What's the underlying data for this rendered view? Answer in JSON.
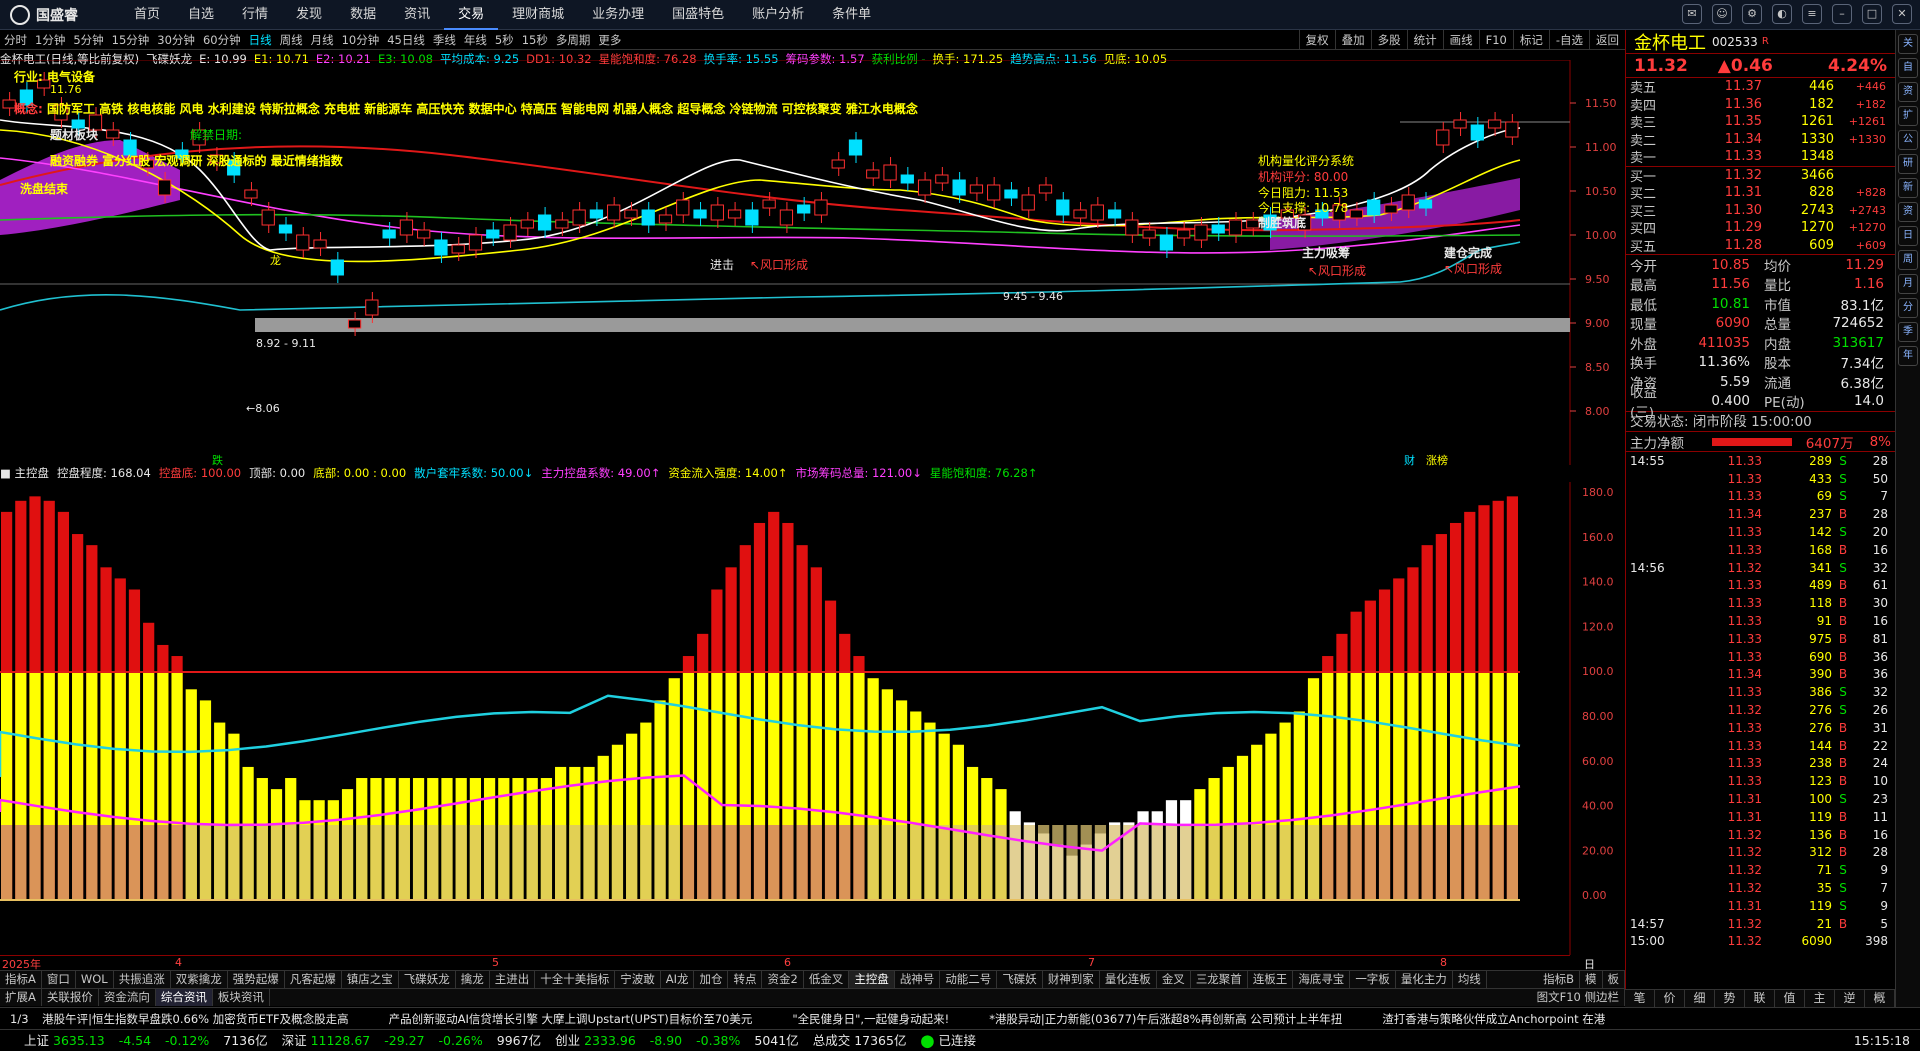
{
  "menu": {
    "logo": "国盛睿",
    "items": [
      "首页",
      "自选",
      "行情",
      "发现",
      "数据",
      "资讯",
      "交易",
      "理财商城",
      "业务办理",
      "国盛特色",
      "账户分析",
      "条件单"
    ],
    "active": "交易"
  },
  "periods": {
    "items": [
      "分时",
      "1分钟",
      "5分钟",
      "15分钟",
      "30分钟",
      "60分钟",
      "日线",
      "周线",
      "月线",
      "10分钟",
      "45日线",
      "季线",
      "年线",
      "5秒",
      "15秒",
      "多周期",
      "更多"
    ],
    "active": "日线"
  },
  "right_tools": [
    "复权",
    "叠加",
    "多股",
    "统计",
    "画线",
    "F10",
    "标记",
    "-自选",
    "返回"
  ],
  "indicator_line": {
    "name": "金杯电工(日线,等比前复权)",
    "items": [
      {
        "t": "飞碟妖龙",
        "c": "white"
      },
      {
        "t": "E: 10.99",
        "c": "white"
      },
      {
        "t": "E1: 10.71",
        "c": "yellow"
      },
      {
        "t": "E2: 10.21",
        "c": "mag"
      },
      {
        "t": "E3: 10.08",
        "c": "green"
      },
      {
        "t": "平均成本: 9.25",
        "c": "cyan"
      },
      {
        "t": "DD1: 10.32",
        "c": "red"
      },
      {
        "t": "星能饱和度: 76.28",
        "c": "red"
      },
      {
        "t": "换手率: 15.55",
        "c": "cyan"
      },
      {
        "t": "筹码参数: 1.57",
        "c": "mag"
      },
      {
        "t": "获利比例 -",
        "c": "green"
      },
      {
        "t": "换手: 171.25",
        "c": "yellow"
      },
      {
        "t": "趋势高点: 11.56",
        "c": "cyan"
      },
      {
        "t": "见底: 10.05",
        "c": "yellow"
      }
    ]
  },
  "concepts": {
    "sector_label": "行业:",
    "sector": "电气设备",
    "concept_label": "概念:",
    "list": "国防军工 高铁 核电核能 风电 水利建设 特斯拉概念 充电桩 新能源车 高压快充 数据中心 特高压 智能电网 机器人概念 超导概念 冷链物流 可控核聚变 雅江水电概念"
  },
  "chart_annotations": {
    "jiejin": "解禁日期:",
    "board": "题材板块",
    "fin": "融资融券 富分红股 宏观调研 深股通标的 最近情绪指数",
    "wash": "洗盘结束",
    "eval_title": "机构量化评分系统",
    "eval_score": "机构评分: 80.00",
    "resist": "今日阻力: 11.53",
    "support": "今日支撑: 10.78",
    "victory": "制胜筑底",
    "absorb": "主力吸筹",
    "storm1": "↖风口形成",
    "storm2": "↖风口形成",
    "storm3": "↖风口形成",
    "built": "建仓完成",
    "attack": "进击",
    "low1": "←8.06",
    "range1": "8.92 - 9.11",
    "range2": "9.45 - 9.46",
    "hi_label": "11.76",
    "tag_die": "跌",
    "tag_cai": "财",
    "tag_zb": "涨榜",
    "tag_long": "龙"
  },
  "price_axis": [
    "11.50",
    "11.00",
    "10.50",
    "10.00",
    "9.50",
    "9.00",
    "8.50",
    "8.00"
  ],
  "indicator2_line": {
    "name": "主控盘",
    "items": [
      {
        "t": "控盘程度: 168.04",
        "c": "white"
      },
      {
        "t": "控盘底: 100.00",
        "c": "red"
      },
      {
        "t": "顶部: 0.00",
        "c": "white"
      },
      {
        "t": "底部: 0.00 : 0.00",
        "c": "yellow"
      },
      {
        "t": "散户套牢系数: 50.00↓",
        "c": "cyan"
      },
      {
        "t": "主力控盘系数: 49.00↑",
        "c": "mag"
      },
      {
        "t": "资金流入强度: 14.00↑",
        "c": "yellow"
      },
      {
        "t": "市场筹码总量: 121.00↓",
        "c": "mag"
      },
      {
        "t": "星能饱和度: 76.28↑",
        "c": "green"
      }
    ]
  },
  "ind_axis": [
    "180.0",
    "160.0",
    "140.0",
    "120.0",
    "100.0",
    "80.00",
    "60.00",
    "40.00",
    "20.00",
    "0.00"
  ],
  "dates": [
    "2025年",
    "4",
    "5",
    "6",
    "7",
    "8"
  ],
  "date_right": "日线",
  "tabs1": [
    "指标A",
    "窗口",
    "WOL",
    "共振追涨",
    "双紫擒龙",
    "强势起爆",
    "凡客起爆",
    "镇店之宝",
    "飞碟妖龙",
    "擒龙",
    "主进出",
    "十全十美指标",
    "宁波敢",
    "AI龙",
    "加仓",
    "转点",
    "资金2",
    "低金叉",
    "主控盘",
    "战神号",
    "动能二号",
    "飞碟妖",
    "财神到家",
    "量化连板",
    "金叉",
    "三龙聚首",
    "连板王",
    "海底寻宝",
    "一字板",
    "量化主力",
    "均线"
  ],
  "tabs1_active": "主控盘",
  "tabs1_right": [
    "指标B",
    "模",
    "板"
  ],
  "tabs2": [
    "扩展A",
    "关联报价",
    "资金流向",
    "综合资讯",
    "板块资讯"
  ],
  "tabs2_active": "综合资讯",
  "tabs2_right": "图文F10 侧边栏",
  "stock": {
    "name": "金杯电工",
    "code": "002533",
    "tag": "R",
    "price": "11.32",
    "change": "0.46",
    "pct": "4.24%"
  },
  "sells": [
    {
      "l": "卖五",
      "p": "11.37",
      "v": "446",
      "c": "+446"
    },
    {
      "l": "卖四",
      "p": "11.36",
      "v": "182",
      "c": "+182"
    },
    {
      "l": "卖三",
      "p": "11.35",
      "v": "1261",
      "c": "+1261"
    },
    {
      "l": "卖二",
      "p": "11.34",
      "v": "1330",
      "c": "+1330"
    },
    {
      "l": "卖一",
      "p": "11.33",
      "v": "1348",
      "c": ""
    }
  ],
  "buys": [
    {
      "l": "买一",
      "p": "11.32",
      "v": "3466",
      "c": ""
    },
    {
      "l": "买二",
      "p": "11.31",
      "v": "828",
      "c": "+828"
    },
    {
      "l": "买三",
      "p": "11.30",
      "v": "2743",
      "c": "+2743"
    },
    {
      "l": "买四",
      "p": "11.29",
      "v": "1270",
      "c": "+1270"
    },
    {
      "l": "买五",
      "p": "11.28",
      "v": "609",
      "c": "+609"
    }
  ],
  "quote": [
    {
      "k": "今开",
      "v": "10.85",
      "vc": "red",
      "k2": "均价",
      "v2": "11.29",
      "v2c": "red"
    },
    {
      "k": "最高",
      "v": "11.56",
      "vc": "red",
      "k2": "量比",
      "v2": "1.16",
      "v2c": "red"
    },
    {
      "k": "最低",
      "v": "10.81",
      "vc": "green",
      "k2": "市值",
      "v2": "83.1亿",
      "v2c": "white"
    },
    {
      "k": "现量",
      "v": "6090",
      "vc": "red",
      "k2": "总量",
      "v2": "724652",
      "v2c": "white"
    },
    {
      "k": "外盘",
      "v": "411035",
      "vc": "red",
      "k2": "内盘",
      "v2": "313617",
      "v2c": "green"
    },
    {
      "k": "换手",
      "v": "11.36%",
      "vc": "white",
      "k2": "股本",
      "v2": "7.34亿",
      "v2c": "white"
    },
    {
      "k": "净资",
      "v": "5.59",
      "vc": "white",
      "k2": "流通",
      "v2": "6.38亿",
      "v2c": "white"
    },
    {
      "k": "收益(三)",
      "v": "0.400",
      "vc": "white",
      "k2": "PE(动)",
      "v2": "14.0",
      "v2c": "white"
    }
  ],
  "trade_status": "交易状态: 闭市阶段 15:00:00",
  "net_inflow": {
    "label": "主力净额",
    "value": "6407万",
    "pct": "8%"
  },
  "ticks": [
    {
      "t": "14:55",
      "p": "11.33",
      "v": "289",
      "s": "S",
      "n": "28"
    },
    {
      "t": "",
      "p": "11.33",
      "v": "433",
      "s": "S",
      "n": "50"
    },
    {
      "t": "",
      "p": "11.33",
      "v": "69",
      "s": "S",
      "n": "7"
    },
    {
      "t": "",
      "p": "11.34",
      "v": "237",
      "s": "B",
      "n": "28"
    },
    {
      "t": "",
      "p": "11.33",
      "v": "142",
      "s": "S",
      "n": "20"
    },
    {
      "t": "",
      "p": "11.33",
      "v": "168",
      "s": "B",
      "n": "16"
    },
    {
      "t": "14:56",
      "p": "11.32",
      "v": "341",
      "s": "S",
      "n": "32"
    },
    {
      "t": "",
      "p": "11.33",
      "v": "489",
      "s": "B",
      "n": "61"
    },
    {
      "t": "",
      "p": "11.33",
      "v": "118",
      "s": "B",
      "n": "30"
    },
    {
      "t": "",
      "p": "11.33",
      "v": "91",
      "s": "B",
      "n": "16"
    },
    {
      "t": "",
      "p": "11.33",
      "v": "975",
      "s": "B",
      "n": "81"
    },
    {
      "t": "",
      "p": "11.33",
      "v": "690",
      "s": "B",
      "n": "36"
    },
    {
      "t": "",
      "p": "11.34",
      "v": "390",
      "s": "B",
      "n": "36"
    },
    {
      "t": "",
      "p": "11.33",
      "v": "386",
      "s": "S",
      "n": "32"
    },
    {
      "t": "",
      "p": "11.32",
      "v": "276",
      "s": "S",
      "n": "26"
    },
    {
      "t": "",
      "p": "11.33",
      "v": "276",
      "s": "B",
      "n": "31"
    },
    {
      "t": "",
      "p": "11.33",
      "v": "144",
      "s": "B",
      "n": "22"
    },
    {
      "t": "",
      "p": "11.33",
      "v": "238",
      "s": "B",
      "n": "24"
    },
    {
      "t": "",
      "p": "11.33",
      "v": "123",
      "s": "B",
      "n": "10"
    },
    {
      "t": "",
      "p": "11.31",
      "v": "100",
      "s": "S",
      "n": "23"
    },
    {
      "t": "",
      "p": "11.31",
      "v": "119",
      "s": "B",
      "n": "11"
    },
    {
      "t": "",
      "p": "11.32",
      "v": "136",
      "s": "B",
      "n": "16"
    },
    {
      "t": "",
      "p": "11.32",
      "v": "312",
      "s": "B",
      "n": "28"
    },
    {
      "t": "",
      "p": "11.32",
      "v": "71",
      "s": "S",
      "n": "9"
    },
    {
      "t": "",
      "p": "11.32",
      "v": "35",
      "s": "S",
      "n": "7"
    },
    {
      "t": "",
      "p": "11.31",
      "v": "119",
      "s": "S",
      "n": "9"
    },
    {
      "t": "14:57",
      "p": "11.32",
      "v": "21",
      "s": "B",
      "n": "5"
    },
    {
      "t": "15:00",
      "p": "11.32",
      "v": "6090",
      "s": "",
      "n": "398"
    }
  ],
  "rbottom_tabs": [
    "笔",
    "价",
    "细",
    "势",
    "联",
    "值",
    "主",
    "逆",
    "概"
  ],
  "sidebar_icons": [
    "关注",
    "自选",
    "资讯",
    "扩展",
    "公告",
    "研报",
    "新闻",
    "资金",
    "日",
    "周",
    "月",
    "分",
    "季",
    "年"
  ],
  "ticker": {
    "page": "1/3",
    "items": [
      "港股午评|恒生指数早盘跌0.66% 加密货币ETF及概念股走高",
      "产品创新驱动AI信贷增长引擎 大摩上调Upstart(UPST)目标价至70美元",
      "\"全民健身日\",一起健身动起来!",
      "*港股异动|正力新能(03677)午后涨超8%再创新高 公司预计上半年扭",
      "渣打香港与策略伙伴成立Anchorpoint 在港"
    ]
  },
  "status": {
    "sh_label": "上证",
    "sh": "3635.13",
    "sh_ch": "-4.54",
    "sh_pct": "-0.12%",
    "sh_amt": "7136亿",
    "sz_label": "深证",
    "sz": "11128.67",
    "sz_ch": "-29.27",
    "sz_pct": "-0.26%",
    "sz_amt": "9967亿",
    "cy_label": "创业",
    "cy": "2333.96",
    "cy_ch": "-8.90",
    "cy_pct": "-0.38%",
    "cy_amt": "5041亿",
    "total_label": "总成交",
    "total": "17365亿",
    "conn": "已连接",
    "time": "15:15:18"
  }
}
